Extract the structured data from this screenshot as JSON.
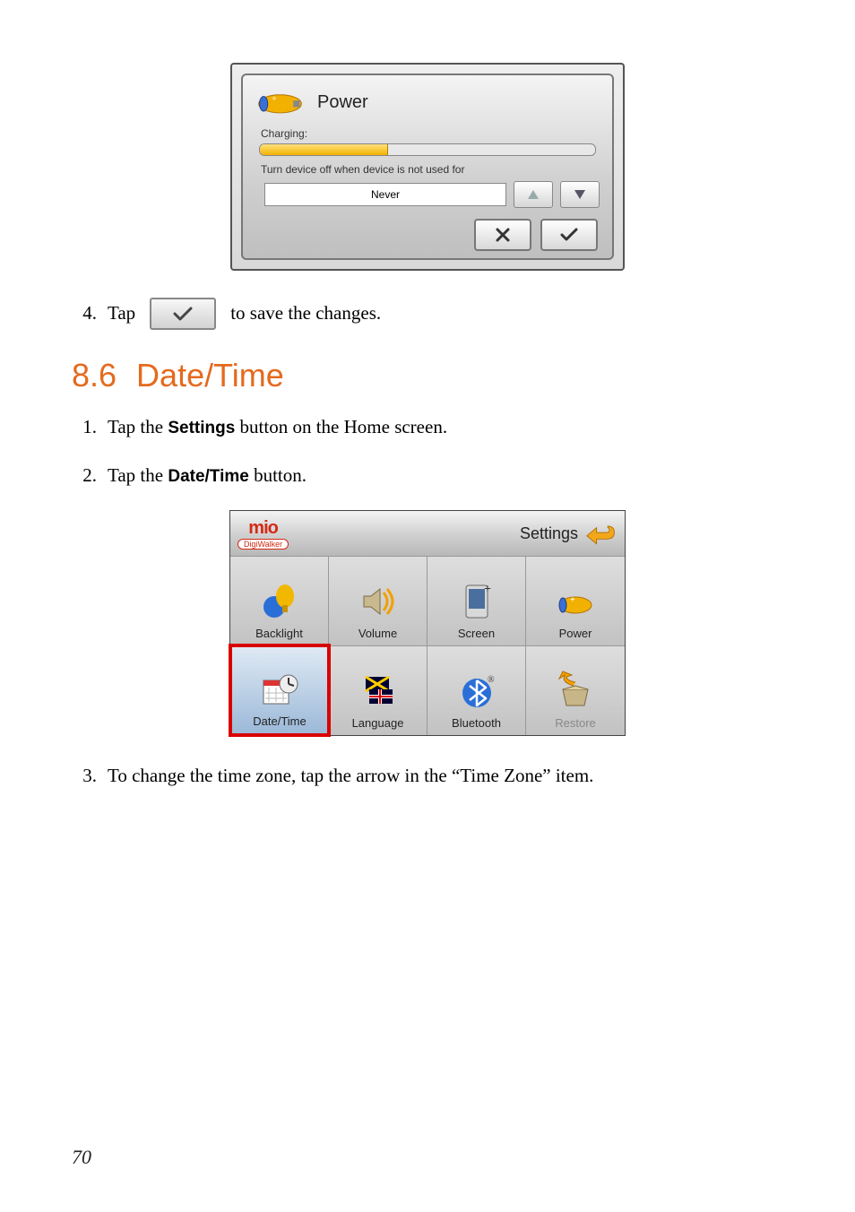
{
  "power_dialog": {
    "title": "Power",
    "charging_label": "Charging:",
    "charge_percent": 38,
    "turnoff_label": "Turn device off when device is not used for",
    "combo_value": "Never"
  },
  "step4": {
    "num": "4.",
    "before": "Tap",
    "after": "to save the changes."
  },
  "heading": {
    "num": "8.6",
    "title": "Date/Time"
  },
  "step1": {
    "num": "1.",
    "before": "Tap the ",
    "bold": "Settings",
    "after": " button on the Home screen."
  },
  "step2": {
    "num": "2.",
    "before": "Tap the ",
    "bold": "Date/Time",
    "after": " button."
  },
  "settings_screen": {
    "logo_sub": "DigiWalker",
    "title": "Settings",
    "items": [
      {
        "label": "Backlight"
      },
      {
        "label": "Volume"
      },
      {
        "label": "Screen"
      },
      {
        "label": "Power"
      },
      {
        "label": "Date/Time"
      },
      {
        "label": "Language"
      },
      {
        "label": "Bluetooth"
      },
      {
        "label": "Restore"
      }
    ]
  },
  "step3": {
    "num": "3.",
    "text": "To change the time zone, tap the arrow in the “Time Zone” item."
  },
  "page_number": "70"
}
